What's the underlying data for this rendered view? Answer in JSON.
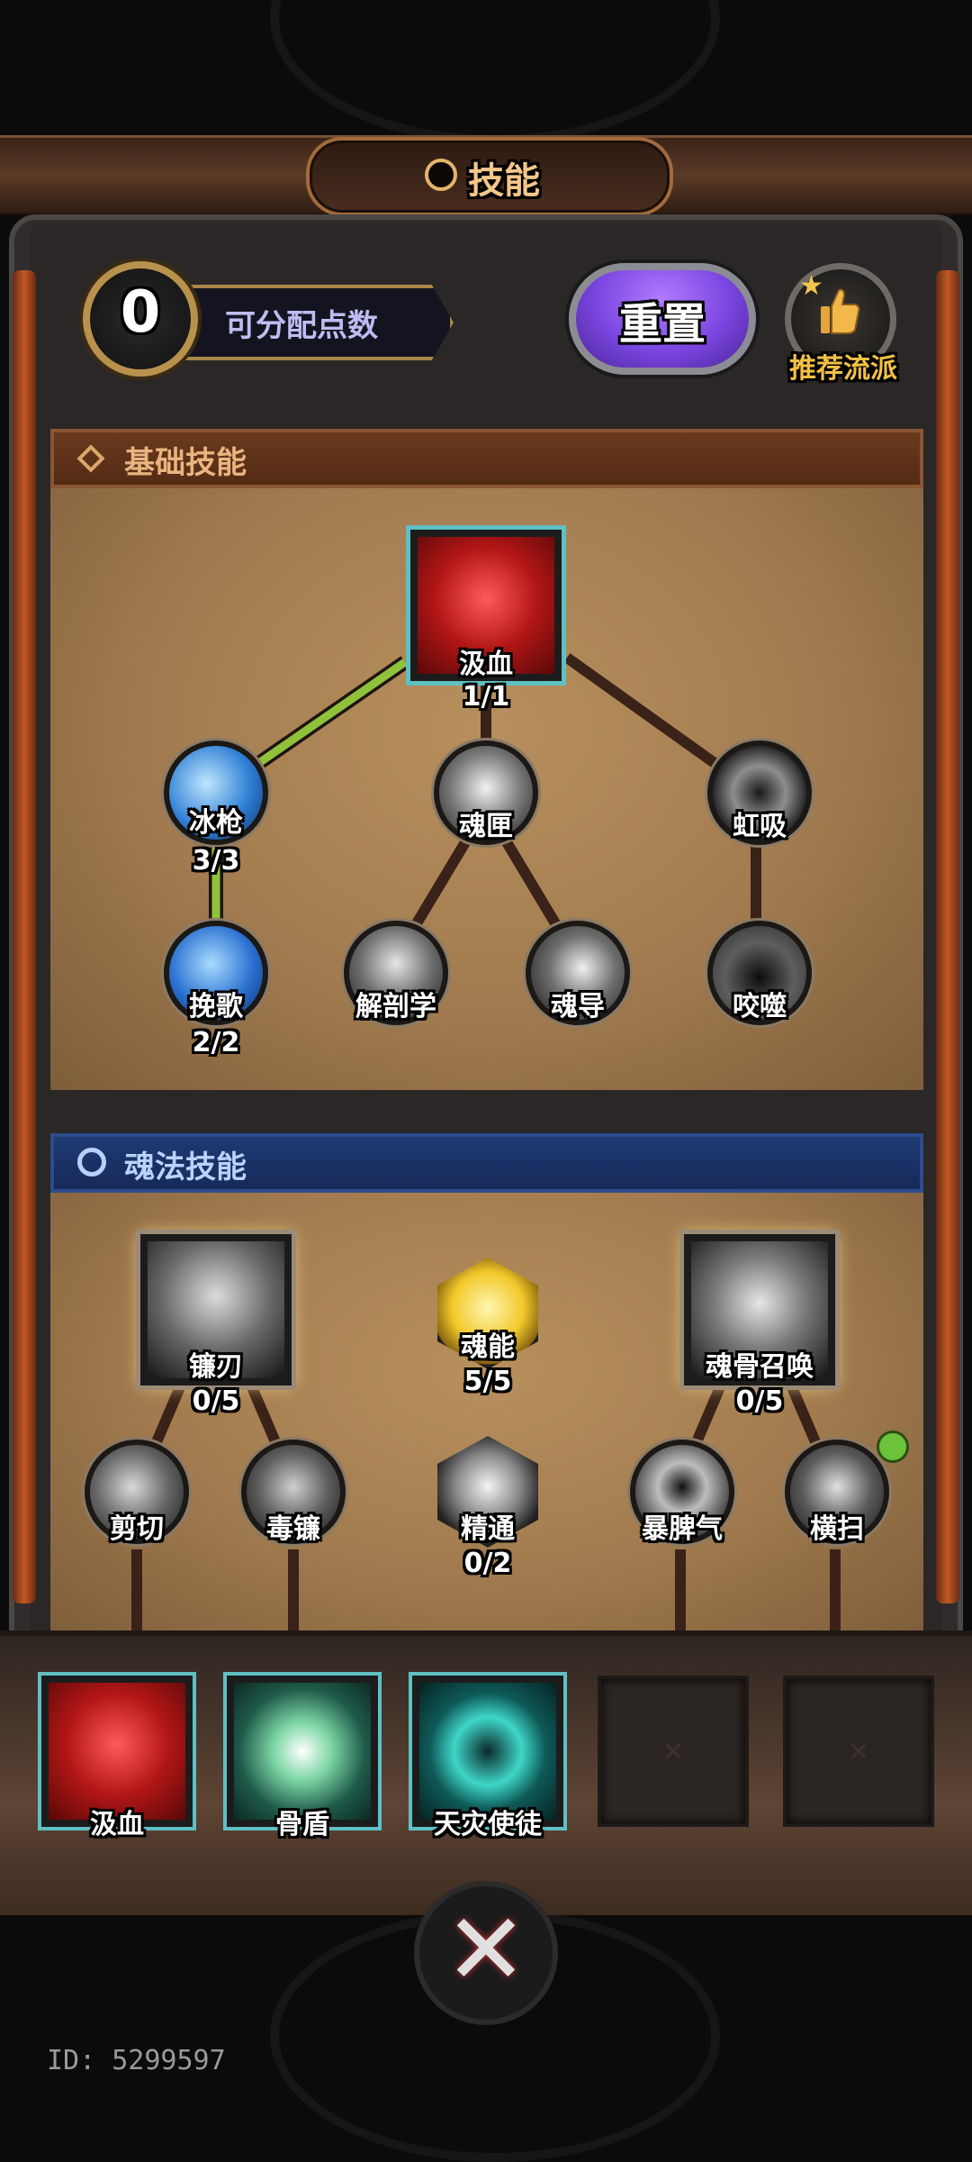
{
  "header": {
    "title": "技能"
  },
  "points": {
    "value": "0",
    "label": "可分配点数"
  },
  "actions": {
    "reset_label": "重置",
    "recommend_label": "推荐流派"
  },
  "basic_section": {
    "title": "基础技能",
    "nodes": {
      "drain": {
        "name": "汲血",
        "level": "1/1"
      },
      "ice_lance": {
        "name": "冰枪",
        "level": "3/3"
      },
      "soul_box": {
        "name": "魂匣"
      },
      "rainbow_siphon": {
        "name": "虹吸"
      },
      "elegy": {
        "name": "挽歌",
        "level": "2/2"
      },
      "anatomy": {
        "name": "解剖学"
      },
      "soul_guide": {
        "name": "魂导"
      },
      "devour": {
        "name": "咬噬"
      }
    }
  },
  "soul_section": {
    "title": "魂法技能",
    "nodes": {
      "scythe_blade": {
        "name": "镰刃",
        "level": "0/5"
      },
      "soul_energy": {
        "name": "魂能",
        "level": "5/5"
      },
      "bone_summon": {
        "name": "魂骨召唤",
        "level": "0/5"
      },
      "shear": {
        "name": "剪切"
      },
      "venom_scythe": {
        "name": "毒镰"
      },
      "mastery": {
        "name": "精通",
        "level": "0/2"
      },
      "tantrum": {
        "name": "暴脾气"
      },
      "sweep": {
        "name": "横扫"
      }
    }
  },
  "equipped": {
    "slots": [
      {
        "name": "汲血"
      },
      {
        "name": "骨盾"
      },
      {
        "name": "天灾使徒"
      },
      {
        "name": ""
      },
      {
        "name": ""
      }
    ]
  },
  "footer": {
    "user_id": "ID: 5299597"
  },
  "colors": {
    "active_link": "#8fc23a",
    "inactive_link": "#3a2218",
    "soul_header": "#1e3a73",
    "basic_header": "#6a3a1e"
  }
}
